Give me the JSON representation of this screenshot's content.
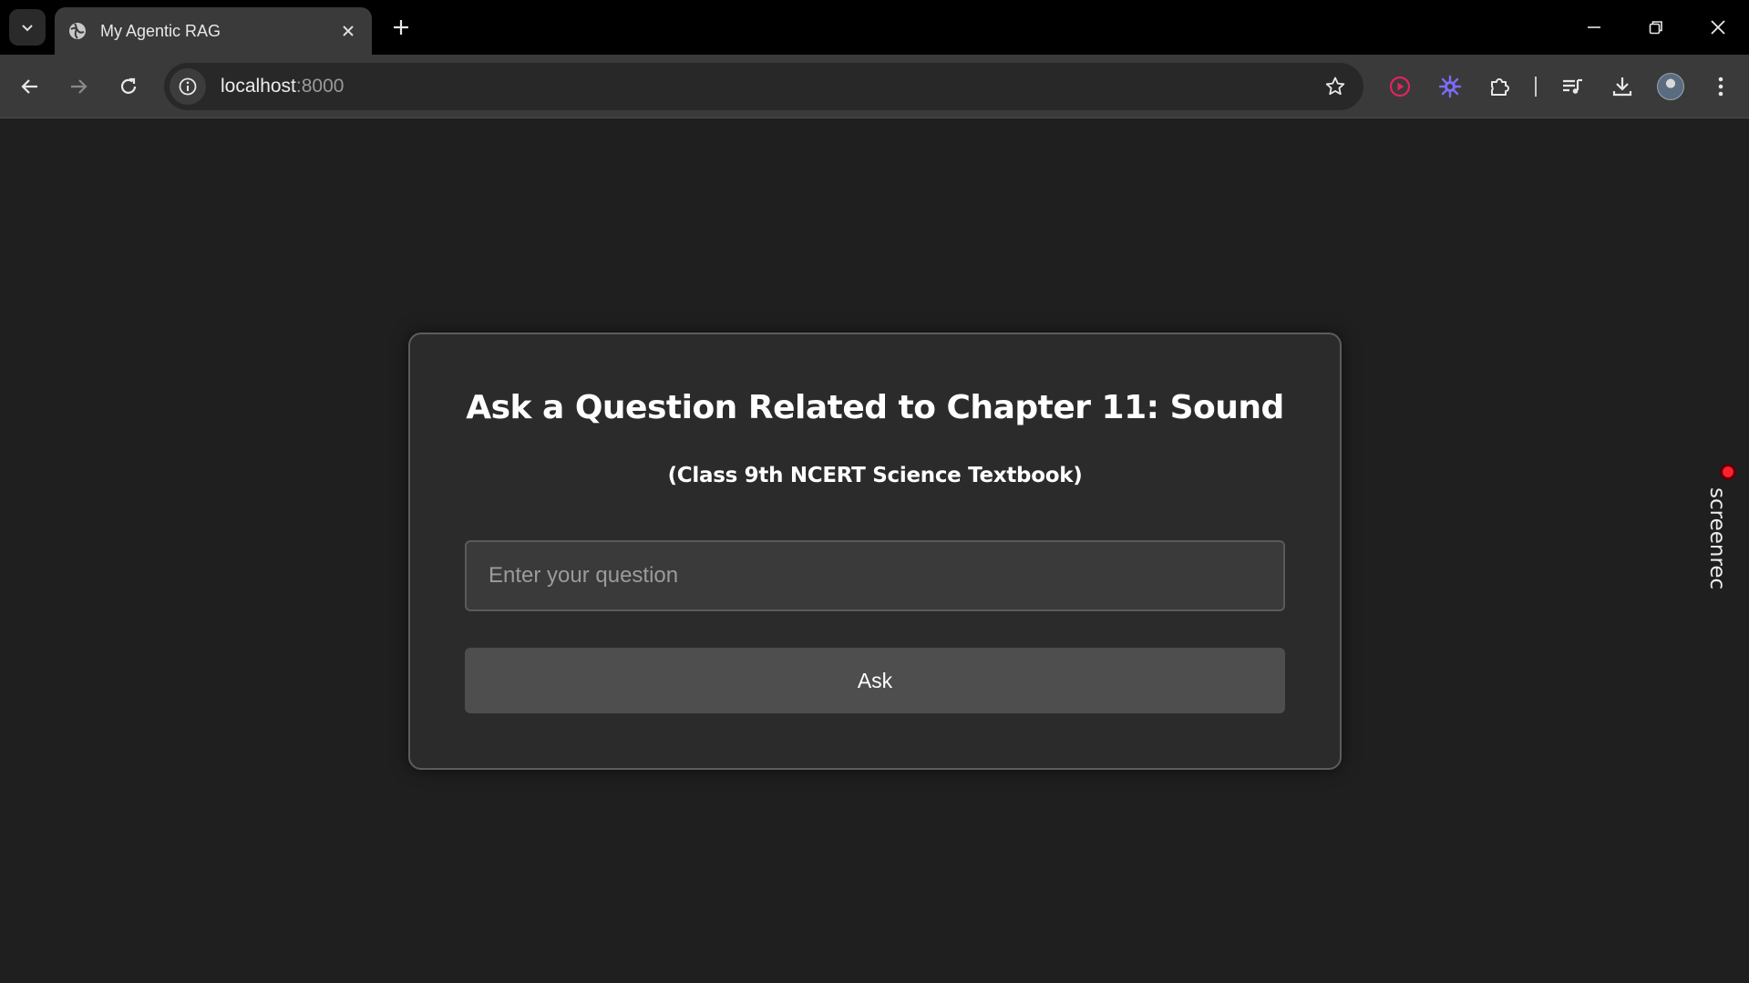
{
  "browser": {
    "tab": {
      "title": "My Agentic RAG"
    },
    "address_bar": {
      "host": "localhost",
      "port": ":8000"
    }
  },
  "card": {
    "title": "Ask a Question Related to Chapter 11: Sound",
    "subtitle": "(Class 9th NCERT Science Textbook)",
    "question_input": {
      "value": "",
      "placeholder": "Enter your question"
    },
    "ask_button": {
      "label": "Ask"
    }
  },
  "screenrec": {
    "label": "screenrec"
  },
  "icons": {
    "extension_1": "screen-record-icon",
    "extension_2": "perplexity-icon",
    "extension_3": "puzzle-icon",
    "media": "media-queue-icon",
    "download": "download-icon"
  },
  "colors": {
    "page_bg": "#1f1f1f",
    "card_bg": "#2b2b2b",
    "button_bg": "#4e4e4e",
    "rec_red": "#ff1f2d",
    "ext_red": "#e0245e",
    "ext_purple": "#7b6cf6"
  }
}
